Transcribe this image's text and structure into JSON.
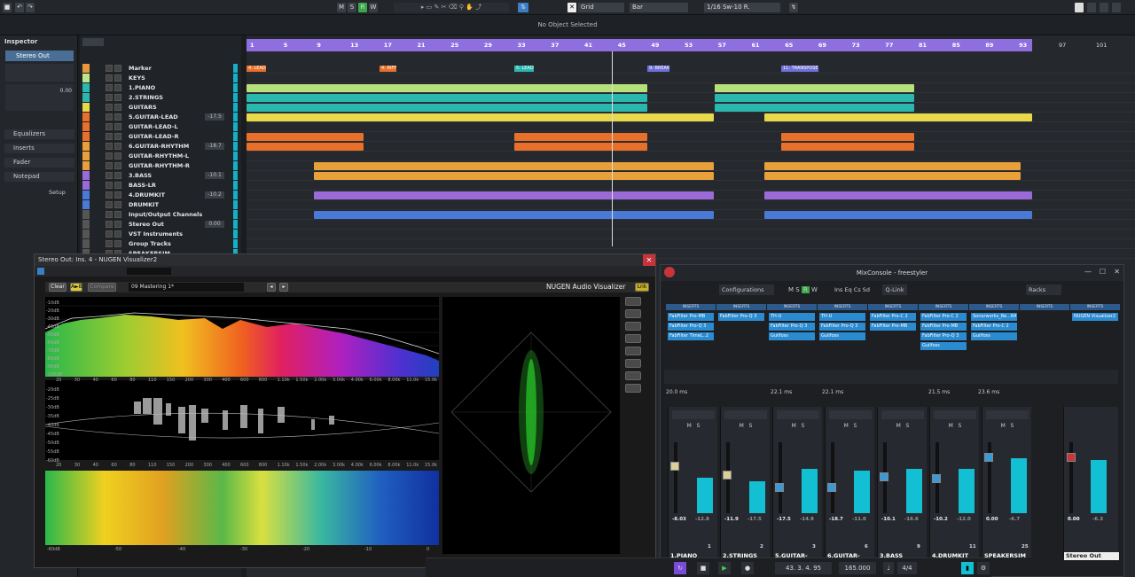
{
  "toolbar": {
    "mode_buttons": [
      "M",
      "S",
      "R",
      "W"
    ],
    "grid_label": "Grid",
    "bar_label": "Bar",
    "quantize_label": "1/16 Sw-10 R."
  },
  "status": {
    "text": "No Object Selected"
  },
  "inspector": {
    "tab": "Inspector",
    "track": "Stereo Out",
    "vol_value": "0.00",
    "sections": [
      "Equalizers",
      "Inserts",
      "Fader",
      "Notepad"
    ],
    "setup": "Setup"
  },
  "tracks": [
    {
      "name": "Marker",
      "color": "#e8973a",
      "vol": ""
    },
    {
      "name": "KEYS",
      "color": "#bde68a",
      "vol": ""
    },
    {
      "name": "1.PIANO",
      "color": "#2ab7b0",
      "vol": ""
    },
    {
      "name": "2.STRINGS",
      "color": "#2ab7b0",
      "vol": ""
    },
    {
      "name": "GUITARS",
      "color": "#e8d94a",
      "vol": ""
    },
    {
      "name": "5.GUITAR-LEAD",
      "color": "#e8702a",
      "vol": "-17.5"
    },
    {
      "name": "GUITAR-LEAD-L",
      "color": "#e8702a",
      "vol": ""
    },
    {
      "name": "GUITAR-LEAD-R",
      "color": "#e8702a",
      "vol": ""
    },
    {
      "name": "6.GUITAR-RHYTHM",
      "color": "#e8a03a",
      "vol": "-18.7"
    },
    {
      "name": "GUITAR-RHYTHM-L",
      "color": "#e8a03a",
      "vol": ""
    },
    {
      "name": "GUITAR-RHYTHM-R",
      "color": "#e8a03a",
      "vol": ""
    },
    {
      "name": "3.BASS",
      "color": "#9a6ad8",
      "vol": "-10.1"
    },
    {
      "name": "BASS-LR",
      "color": "#9a6ad8",
      "vol": ""
    },
    {
      "name": "4.DRUMKIT",
      "color": "#4a7ad8",
      "vol": "-10.2"
    },
    {
      "name": "DRUMKIT",
      "color": "#4a7ad8",
      "vol": ""
    },
    {
      "name": "Input/Output Channels",
      "color": "#555",
      "vol": ""
    },
    {
      "name": "Stereo Out",
      "color": "#555",
      "vol": "0.00"
    },
    {
      "name": "VST Instruments",
      "color": "#555",
      "vol": ""
    },
    {
      "name": "Group Tracks",
      "color": "#555",
      "vol": ""
    },
    {
      "name": "SPEAKERSIM",
      "color": "#555",
      "vol": ""
    }
  ],
  "ruler": [
    "1",
    "5",
    "9",
    "13",
    "17",
    "21",
    "25",
    "29",
    "33",
    "37",
    "41",
    "45",
    "49",
    "53",
    "57",
    "61",
    "65",
    "69",
    "73",
    "77",
    "81",
    "85",
    "89",
    "93"
  ],
  "ruler_after": [
    "97",
    "101"
  ],
  "markers": [
    {
      "label": "4: LEAD",
      "color": "#e8702a"
    },
    {
      "label": "4: RIFF",
      "color": "#e8702a"
    },
    {
      "label": "5: LEAD",
      "color": "#2ab7b0"
    },
    {
      "label": "9: BREAK",
      "color": "#7070d8"
    },
    {
      "label": "11: TRANSPOSE",
      "color": "#7070d8"
    }
  ],
  "nugen": {
    "title": "Stereo Out: Ins. 4 - NUGEN Visualizer2",
    "preset": "09 Mastering 1*",
    "brand": "NUGEN Audio Visualizer",
    "btn_clear": "Clear",
    "btn_compare": "Compare",
    "freq_labels": [
      "20",
      "30",
      "40",
      "60",
      "80",
      "110",
      "150",
      "200",
      "300",
      "400",
      "600",
      "800",
      "1.10k",
      "1.50k",
      "2.00k",
      "3.00k",
      "4.00k",
      "6.00k",
      "8.00k",
      "11.0k",
      "15.0k"
    ],
    "db_labels_top": [
      "-10dB",
      "-20dB",
      "-30dB",
      "-40dB",
      "-50dB",
      "-60dB",
      "-70dB",
      "-80dB",
      "-90dB",
      "-100dB"
    ],
    "db_labels_mid": [
      "-20dB",
      "-25dB",
      "-30dB",
      "-35dB",
      "-40dB",
      "-45dB",
      "-50dB",
      "-55dB",
      "-60dB"
    ],
    "bottom_scale": [
      "-60dB",
      "-50",
      "-40",
      "-30",
      "-20",
      "-10",
      "0"
    ]
  },
  "mixer": {
    "title": "MixConsole - freestyler",
    "configurations": "Configurations",
    "qlink": "Q-Link",
    "racks": "Racks",
    "insert_header": "INSERTS",
    "delays": [
      "20.0 ms",
      "22.1 ms",
      "22.1 ms",
      "21.5 ms",
      "23.6 ms"
    ],
    "inserts": [
      [
        "FabFilter Pro-MB",
        "FabFilter Pro-Q 3",
        "FabFilter TimeL..2"
      ],
      [
        "FabFilter Pro-Q 3"
      ],
      [
        "TH-U",
        "FabFilter Pro-Q 3",
        "Guilfoss"
      ],
      [
        "TH-U",
        "FabFilter Pro-Q 3",
        "Guilfoss"
      ],
      [
        "FabFilter Pro-C 2",
        "FabFilter Pro-MB"
      ],
      [
        "FabFilter Pro-C 2",
        "FabFilter Pro-MB",
        "FabFilter Pro-Q 3",
        "Guilfoss"
      ],
      [
        "Sonarworks_Re...64",
        "FabFilter Pro-C 2",
        "Guilfoss"
      ],
      [],
      [
        "NUGEN Visualizer2"
      ]
    ],
    "channels": [
      {
        "name": "1.PIANO",
        "db": "-8.03",
        "peak": "-12.8",
        "num": "1"
      },
      {
        "name": "2.STRINGS",
        "db": "-11.9",
        "peak": "-17.5",
        "num": "2"
      },
      {
        "name": "5.GUITAR-LEAD",
        "db": "-17.5",
        "peak": "-14.9",
        "num": "3"
      },
      {
        "name": "6.GUITAR-RHYTH",
        "db": "-18.7",
        "peak": "-11.0",
        "num": "6"
      },
      {
        "name": "3.BASS",
        "db": "-10.1",
        "peak": "-16.6",
        "num": "9"
      },
      {
        "name": "4.DRUMKIT",
        "db": "-10.2",
        "peak": "-12.0",
        "num": "11"
      },
      {
        "name": "SPEAKERSIM",
        "db": "0.00",
        "peak": "-6.7",
        "num": "25"
      }
    ],
    "stereo_out": {
      "name": "Stereo Out",
      "db": "0.00",
      "peak": "-6.3"
    }
  },
  "transport": {
    "position": "43. 3. 4. 95",
    "signature": "4/4",
    "tempo": "165.000"
  }
}
